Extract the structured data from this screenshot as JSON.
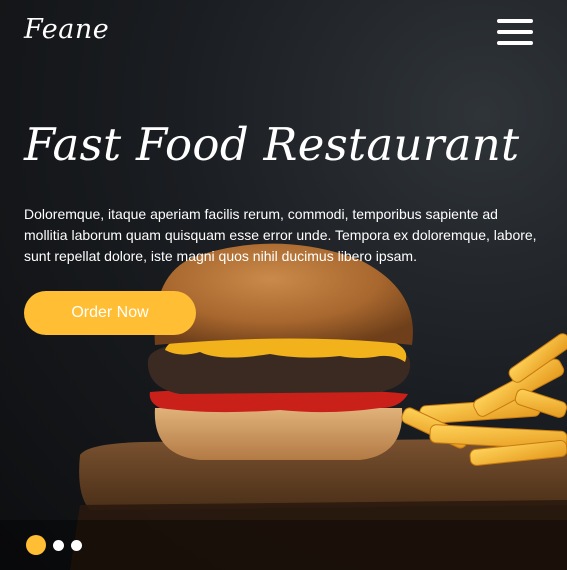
{
  "brand": {
    "logo": "Feane"
  },
  "header": {
    "menu_icon": "hamburger-menu-icon"
  },
  "hero": {
    "headline": "Fast Food Restaurant",
    "description": "Doloremque, itaque aperiam facilis rerum, commodi, temporibus sapiente ad mollitia laborum quam quisquam esse error unde. Tempora ex doloremque, labore, sunt repellat dolore, iste magni quos nihil ducimus libero ipsam.",
    "cta_label": "Order Now",
    "image": "burger-and-fries-image"
  },
  "carousel": {
    "slides": 3,
    "active_index": 0
  },
  "colors": {
    "accent": "#ffbe33",
    "background": "#1a1d21",
    "text": "#ffffff"
  }
}
